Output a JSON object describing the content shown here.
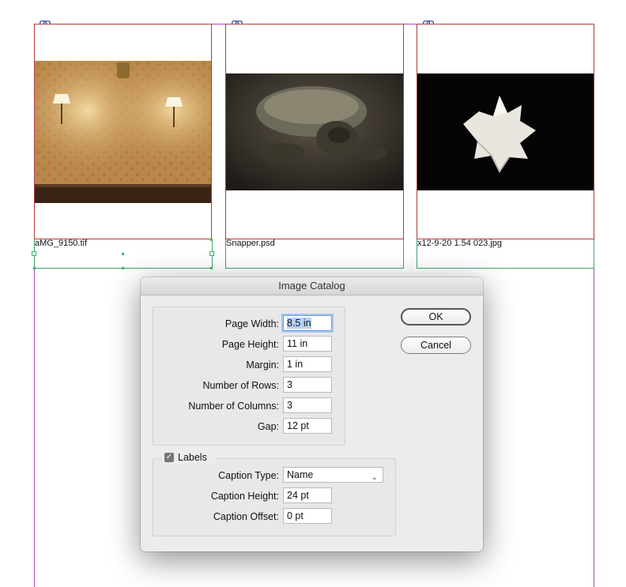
{
  "thumbnails": [
    {
      "caption": "aMG_9150.tif"
    },
    {
      "caption": "Snapper.psd"
    },
    {
      "caption": "x12-9-20 1.54 023.jpg"
    }
  ],
  "dialog": {
    "title": "Image Catalog",
    "fields": [
      {
        "label": "Page Width:",
        "value": "8.5 in"
      },
      {
        "label": "Page Height:",
        "value": "11 in"
      },
      {
        "label": "Margin:",
        "value": "1 in"
      },
      {
        "label": "Number of Rows:",
        "value": "3"
      },
      {
        "label": "Number of Columns:",
        "value": "3"
      },
      {
        "label": "Gap:",
        "value": "12 pt"
      }
    ],
    "labels_group": {
      "checkbox_label": "Labels",
      "checked": true,
      "caption_type_label": "Caption Type:",
      "caption_type_value": "Name",
      "caption_height_label": "Caption Height:",
      "caption_height_value": "24 pt",
      "caption_offset_label": "Caption Offset:",
      "caption_offset_value": "0 pt"
    },
    "ok_label": "OK",
    "cancel_label": "Cancel"
  },
  "colors": {
    "margin_guide": "#b04ad0",
    "image_frame": "#b03a3a",
    "caption_frame": "#3aa86a",
    "dialog_bg": "#ececec"
  }
}
